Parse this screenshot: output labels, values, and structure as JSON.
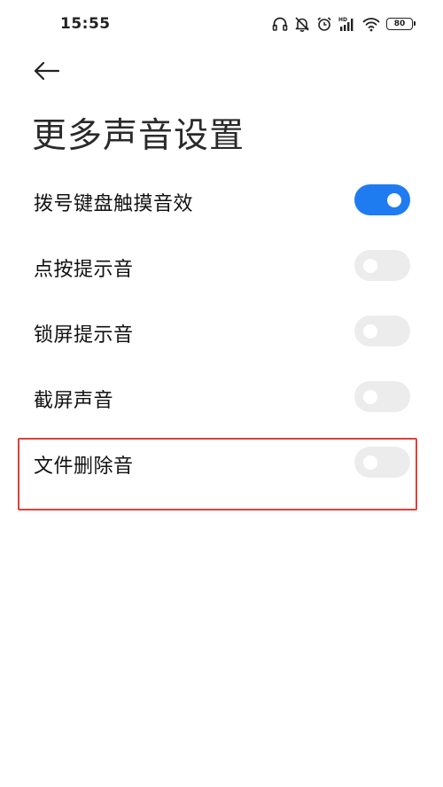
{
  "status_bar": {
    "time": "15:55",
    "battery": "80",
    "signal_label": "HD",
    "icons": [
      "headphones-icon",
      "mute-bell-icon",
      "alarm-icon",
      "signal-icon",
      "wifi-icon",
      "battery-icon"
    ]
  },
  "header": {
    "back_icon": "back-arrow-icon",
    "title": "更多声音设置"
  },
  "settings": [
    {
      "label": "拨号键盘触摸音效",
      "enabled": true
    },
    {
      "label": "点按提示音",
      "enabled": false
    },
    {
      "label": "锁屏提示音",
      "enabled": false
    },
    {
      "label": "截屏声音",
      "enabled": false
    },
    {
      "label": "文件删除音",
      "enabled": false
    }
  ],
  "colors": {
    "toggle_on": "#1f7cf0",
    "toggle_off": "#ececec",
    "highlight": "#e0403a"
  }
}
